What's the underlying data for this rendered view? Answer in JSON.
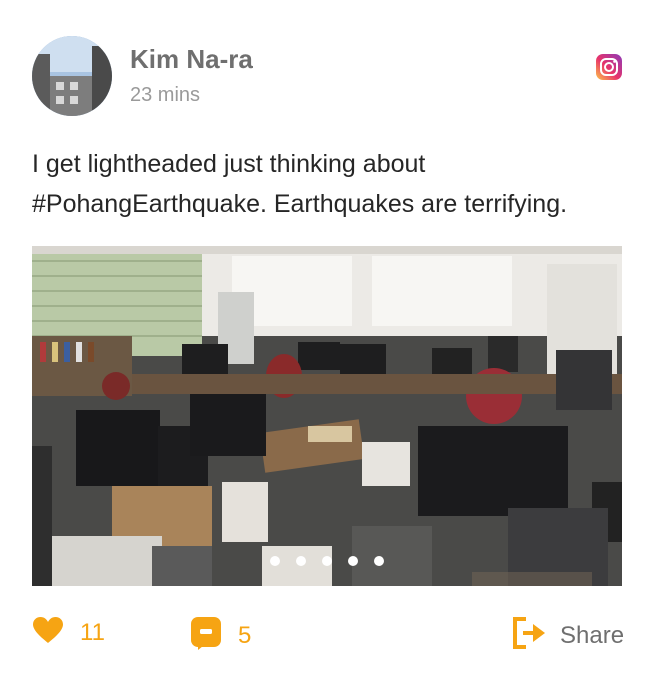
{
  "post": {
    "author": "Kim Na-ra",
    "time_ago": "23 mins",
    "text_line1": "I get lightheaded just thinking about",
    "text_line2": "#PohangEarthquake. Earthquakes are terrifying."
  },
  "carousel": {
    "total_slides": 5,
    "active_index": 0
  },
  "actions": {
    "likes": "11",
    "comments": "5",
    "share_label": "Share"
  },
  "icons": {
    "platform": "instagram-icon",
    "like": "heart-icon",
    "comment": "comment-icon",
    "share": "share-icon"
  },
  "colors": {
    "accent": "#f6a413",
    "text": "#262626",
    "muted": "#9a9a9a"
  }
}
